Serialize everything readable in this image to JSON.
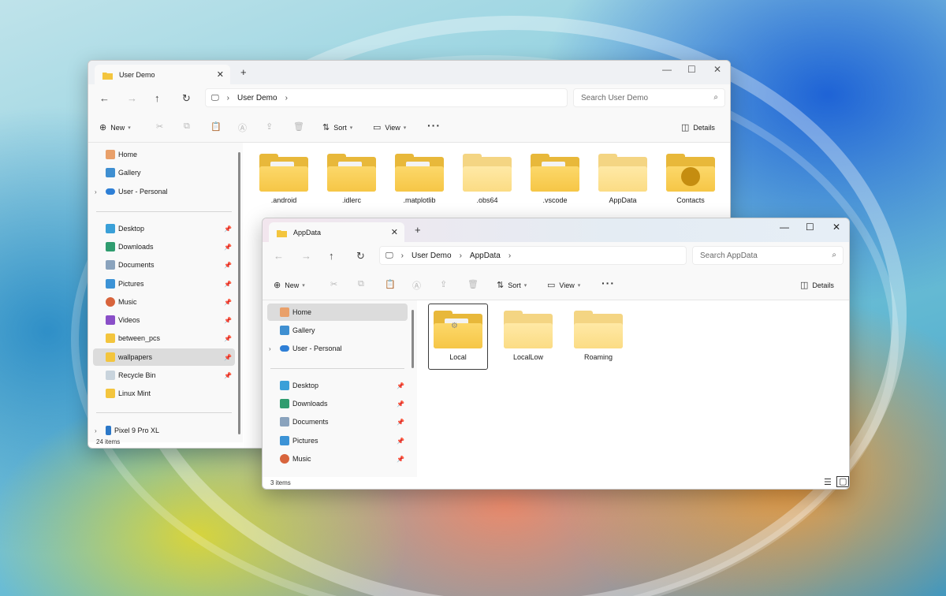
{
  "window_back": {
    "tab_title": "User Demo",
    "new_tab": "+",
    "controls": [
      "—",
      "☐",
      "✕"
    ],
    "address": [
      "User Demo"
    ],
    "search_placeholder": "Search User Demo",
    "toolbar": {
      "new": "New",
      "sort": "Sort",
      "view": "View",
      "details": "Details"
    },
    "sidebar": {
      "top": [
        {
          "label": "Home",
          "icon": "home-icon"
        },
        {
          "label": "Gallery",
          "icon": "gallery-icon"
        },
        {
          "label": "User - Personal",
          "icon": "cloud-icon"
        }
      ],
      "quick": [
        {
          "label": "Desktop",
          "icon": "desktop-icon"
        },
        {
          "label": "Downloads",
          "icon": "download-icon"
        },
        {
          "label": "Documents",
          "icon": "documents-icon"
        },
        {
          "label": "Pictures",
          "icon": "pictures-icon"
        },
        {
          "label": "Music",
          "icon": "music-icon"
        },
        {
          "label": "Videos",
          "icon": "videos-icon"
        },
        {
          "label": "between_pcs",
          "icon": "folder-icon"
        },
        {
          "label": "wallpapers",
          "icon": "folder-icon"
        },
        {
          "label": "Recycle Bin",
          "icon": "recycle-bin-icon"
        },
        {
          "label": "Linux Mint",
          "icon": "folder-icon"
        }
      ],
      "device": {
        "label": "Pixel 9 Pro XL",
        "icon": "phone-icon"
      }
    },
    "folders": [
      ".android",
      ".idlerc",
      ".matplotlib",
      ".obs64",
      ".vscode",
      "AppData",
      "Contacts"
    ],
    "status": "24 items"
  },
  "window_front": {
    "tab_title": "AppData",
    "new_tab": "+",
    "controls": [
      "—",
      "☐",
      "✕"
    ],
    "address": [
      "User Demo",
      "AppData"
    ],
    "search_placeholder": "Search AppData",
    "toolbar": {
      "new": "New",
      "sort": "Sort",
      "view": "View",
      "details": "Details"
    },
    "sidebar": {
      "top": [
        {
          "label": "Home",
          "icon": "home-icon"
        },
        {
          "label": "Gallery",
          "icon": "gallery-icon"
        },
        {
          "label": "User - Personal",
          "icon": "cloud-icon"
        }
      ],
      "quick": [
        {
          "label": "Desktop",
          "icon": "desktop-icon"
        },
        {
          "label": "Downloads",
          "icon": "download-icon"
        },
        {
          "label": "Documents",
          "icon": "documents-icon"
        },
        {
          "label": "Pictures",
          "icon": "pictures-icon"
        },
        {
          "label": "Music",
          "icon": "music-icon"
        }
      ]
    },
    "folders": [
      "Local",
      "LocalLow",
      "Roaming"
    ],
    "status": "3 items"
  },
  "colors": {
    "folder": "#f6c646",
    "folder_back": "#e8b83a",
    "selected_nav": "#dcdcdc",
    "window_bg": "#f9f9f9"
  }
}
